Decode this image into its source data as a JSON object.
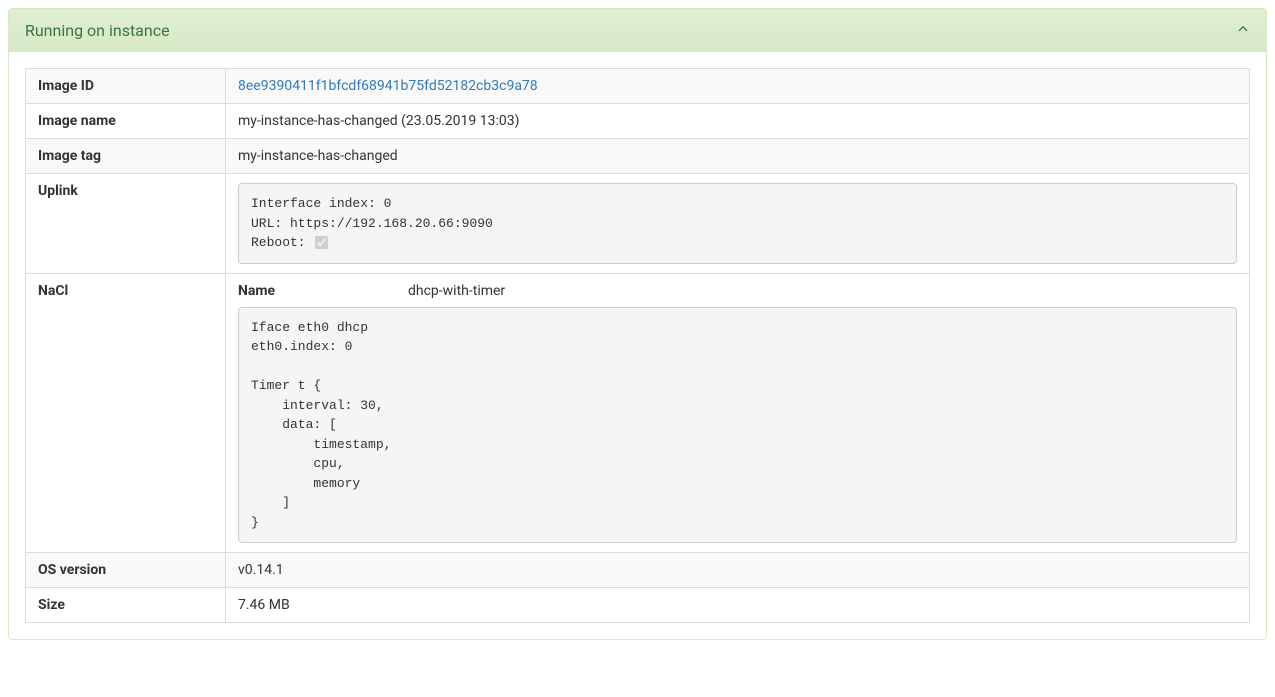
{
  "panel": {
    "title": "Running on instance"
  },
  "rows": {
    "image_id": {
      "label": "Image ID",
      "value": "8ee9390411f1bfcdf68941b75fd52182cb3c9a78"
    },
    "image_name": {
      "label": "Image name",
      "value": "my-instance-has-changed (23.05.2019 13:03)"
    },
    "image_tag": {
      "label": "Image tag",
      "value": "my-instance-has-changed"
    },
    "uplink": {
      "label": "Uplink",
      "line1": "Interface index: 0",
      "line2": "URL: https://192.168.20.66:9090",
      "line3_prefix": "Reboot: ",
      "reboot_checked": true
    },
    "nacl": {
      "label": "NaCl",
      "name_label": "Name",
      "name_value": "dhcp-with-timer",
      "code": "Iface eth0 dhcp\neth0.index: 0\n\nTimer t {\n    interval: 30,\n    data: [\n        timestamp,\n        cpu,\n        memory\n    ]\n}"
    },
    "os_version": {
      "label": "OS version",
      "value": "v0.14.1"
    },
    "size": {
      "label": "Size",
      "value": "7.46 MB"
    }
  }
}
